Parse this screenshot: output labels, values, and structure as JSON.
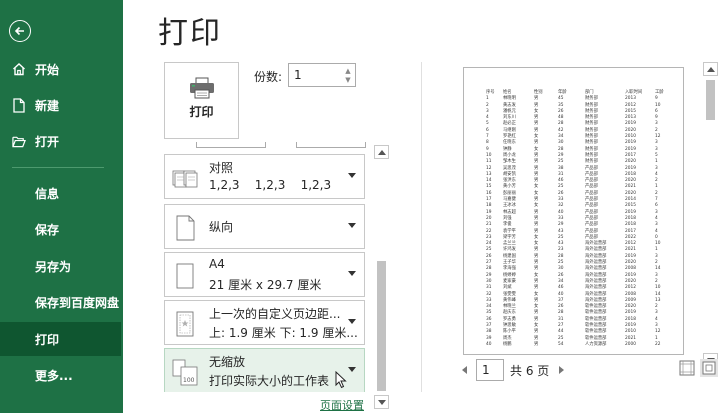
{
  "sidebar": {
    "items": [
      {
        "label": "开始",
        "icon": "home-icon"
      },
      {
        "label": "新建",
        "icon": "new-file-icon"
      },
      {
        "label": "打开",
        "icon": "open-folder-icon"
      },
      {
        "label": "信息"
      },
      {
        "label": "保存"
      },
      {
        "label": "另存为"
      },
      {
        "label": "保存到百度网盘"
      },
      {
        "label": "打印",
        "active": true
      },
      {
        "label": "更多..."
      }
    ],
    "bg_color": "#1e7145",
    "active_color": "#0f5630"
  },
  "page_title": "打印",
  "print_button": {
    "label": "打印"
  },
  "copies": {
    "label": "份数:",
    "value": "1"
  },
  "settings": [
    {
      "main": "对照",
      "sub": "1,2,3    1,2,3    1,2,3",
      "icon": "collate-icon"
    },
    {
      "main": "纵向",
      "sub": "",
      "icon": "portrait-icon"
    },
    {
      "main": "A4",
      "sub": "21 厘米 x 29.7 厘米",
      "icon": "paper-size-icon"
    },
    {
      "main": "上一次的自定义页边距...",
      "sub": "上: 1.9 厘米 下: 1.9 厘米...",
      "icon": "margins-icon"
    },
    {
      "main": "无缩放",
      "sub": "打印实际大小的工作表",
      "icon": "no-scaling-icon"
    }
  ],
  "page_setup_link": "页面设置",
  "pager": {
    "current": "1",
    "total": "共 6 页"
  },
  "preview": {
    "header": [
      "序号",
      "姓名",
      "性别",
      "年龄",
      "部门",
      "入职时间",
      "工龄"
    ],
    "rows": [
      [
        "1",
        "林晓明",
        "男",
        "45",
        "财务部",
        "2013",
        "9"
      ],
      [
        "2",
        "黄志发",
        "男",
        "35",
        "财务部",
        "2012",
        "10"
      ],
      [
        "3",
        "潘帆元",
        "女",
        "26",
        "财务部",
        "2015",
        "6"
      ],
      [
        "4",
        "刘东川",
        "男",
        "48",
        "财务部",
        "2013",
        "9"
      ],
      [
        "5",
        "赵必正",
        "男",
        "28",
        "财务部",
        "2019",
        "3"
      ],
      [
        "6",
        "马继刚",
        "男",
        "42",
        "财务部",
        "2020",
        "2"
      ],
      [
        "7",
        "罗艳红",
        "女",
        "34",
        "财务部",
        "2010",
        "12"
      ],
      [
        "8",
        "任晓东",
        "男",
        "30",
        "财务部",
        "2019",
        "3"
      ],
      [
        "9",
        "钟静",
        "女",
        "28",
        "财务部",
        "2019",
        "3"
      ],
      [
        "10",
        "周小龙",
        "男",
        "29",
        "财务部",
        "2017",
        "5"
      ],
      [
        "11",
        "邹木生",
        "男",
        "25",
        "财务部",
        "2020",
        "1"
      ],
      [
        "12",
        "吴思茂",
        "男",
        "38",
        "产品部",
        "2019",
        "3"
      ],
      [
        "13",
        "胡安凯",
        "男",
        "31",
        "产品部",
        "2018",
        "4"
      ],
      [
        "14",
        "张洪东",
        "男",
        "46",
        "产品部",
        "2020",
        "2"
      ],
      [
        "15",
        "黄小芳",
        "女",
        "25",
        "产品部",
        "2021",
        "1"
      ],
      [
        "16",
        "彭丽丽",
        "女",
        "26",
        "产品部",
        "2020",
        "2"
      ],
      [
        "17",
        "马嘉健",
        "男",
        "33",
        "产品部",
        "2014",
        "7"
      ],
      [
        "18",
        "王冰冰",
        "女",
        "32",
        "产品部",
        "2015",
        "6"
      ],
      [
        "19",
        "林志超",
        "男",
        "40",
        "产品部",
        "2019",
        "3"
      ],
      [
        "20",
        "刘强",
        "男",
        "33",
        "产品部",
        "2018",
        "4"
      ],
      [
        "21",
        "李俊",
        "男",
        "29",
        "产品部",
        "2018",
        "3"
      ],
      [
        "22",
        "袁学平",
        "男",
        "43",
        "产品部",
        "2017",
        "4"
      ],
      [
        "23",
        "梁宇芳",
        "女",
        "25",
        "产品部",
        "2022",
        "0"
      ],
      [
        "24",
        "孟兰兰",
        "女",
        "43",
        "海外运营部",
        "2012",
        "10"
      ],
      [
        "25",
        "许鸿发",
        "男",
        "23",
        "海外运营部",
        "2021",
        "1"
      ],
      [
        "26",
        "杨建国",
        "男",
        "28",
        "海外运营部",
        "2019",
        "3"
      ],
      [
        "27",
        "王子华",
        "男",
        "25",
        "海外运营部",
        "2020",
        "2"
      ],
      [
        "28",
        "李海强",
        "男",
        "30",
        "海外运营部",
        "2008",
        "14"
      ],
      [
        "29",
        "杨婷婷",
        "女",
        "26",
        "海外运营部",
        "2019",
        "3"
      ],
      [
        "30",
        "麦家豪",
        "男",
        "34",
        "海外运营部",
        "2020",
        "2"
      ],
      [
        "31",
        "刘斌",
        "男",
        "46",
        "海外运营部",
        "2012",
        "10"
      ],
      [
        "32",
        "张雯雯",
        "女",
        "40",
        "海外运营部",
        "2008",
        "14"
      ],
      [
        "33",
        "黄伟峰",
        "男",
        "37",
        "海外运营部",
        "2009",
        "13"
      ],
      [
        "34",
        "林晓兰",
        "女",
        "26",
        "软件运营部",
        "2020",
        "2"
      ],
      [
        "35",
        "赵庆东",
        "男",
        "28",
        "软件运营部",
        "2019",
        "3"
      ],
      [
        "36",
        "罗志勇",
        "男",
        "31",
        "软件运营部",
        "2018",
        "4"
      ],
      [
        "37",
        "钟思敏",
        "女",
        "27",
        "软件运营部",
        "2019",
        "3"
      ],
      [
        "38",
        "陈小平",
        "男",
        "44",
        "软件运营部",
        "2010",
        "12"
      ],
      [
        "39",
        "周杰",
        "男",
        "25",
        "软件运营部",
        "2021",
        "1"
      ],
      [
        "40",
        "杨鹏",
        "男",
        "54",
        "人力资源部",
        "2000",
        "22"
      ]
    ]
  }
}
